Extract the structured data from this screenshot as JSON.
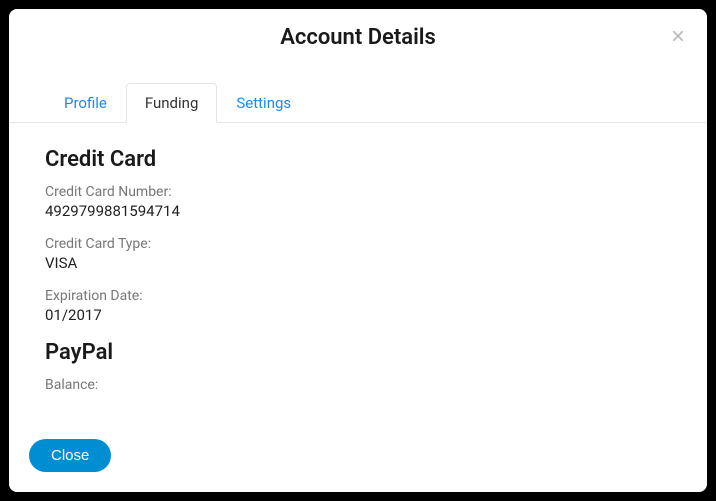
{
  "modal": {
    "title": "Account Details",
    "tabs": {
      "profile": "Profile",
      "funding": "Funding",
      "settings": "Settings"
    },
    "sections": {
      "creditCard": {
        "title": "Credit Card",
        "numberLabel": "Credit Card Number:",
        "numberValue": "4929799881594714",
        "typeLabel": "Credit Card Type:",
        "typeValue": "VISA",
        "expLabel": "Expiration Date:",
        "expValue": "01/2017"
      },
      "paypal": {
        "title": "PayPal",
        "balanceLabel": "Balance:",
        "balanceValue": ""
      }
    },
    "footer": {
      "closeLabel": "Close"
    }
  }
}
